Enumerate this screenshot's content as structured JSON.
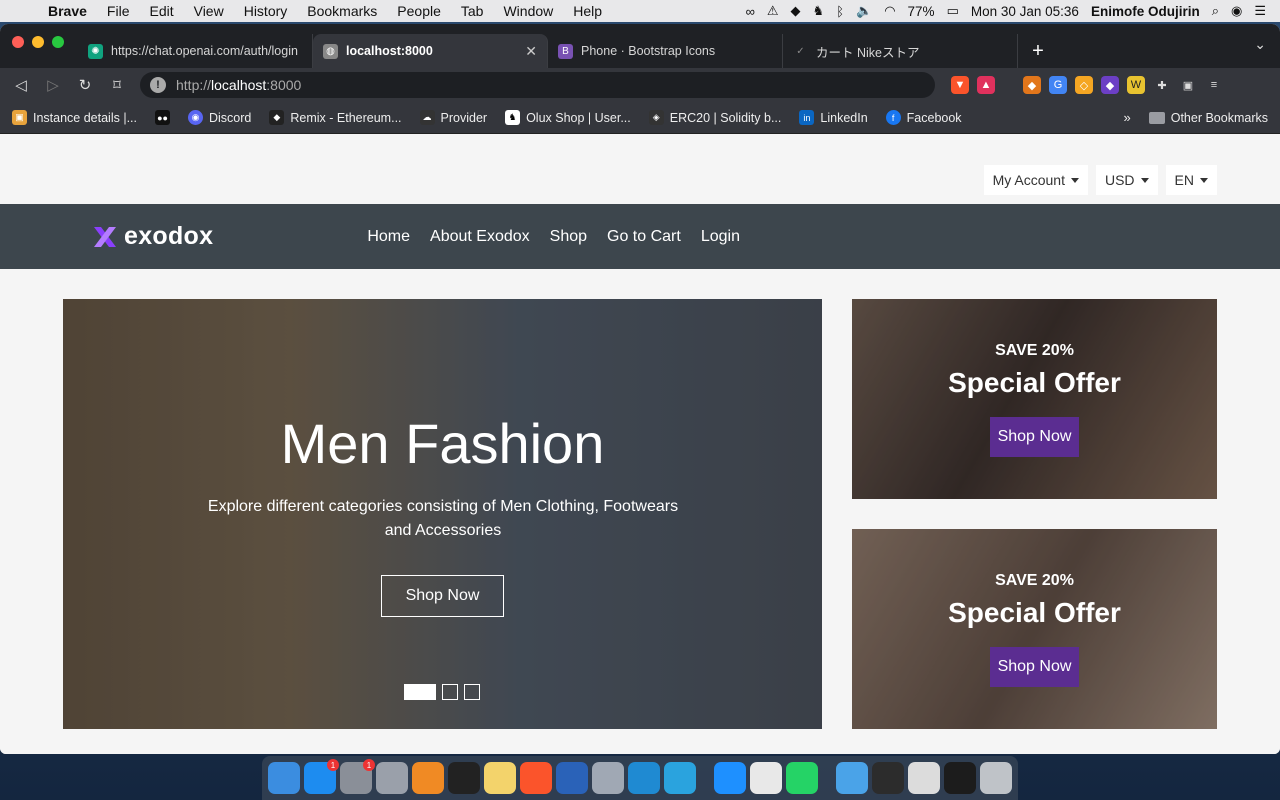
{
  "menubar": {
    "app_name": "Brave",
    "items": [
      "File",
      "Edit",
      "View",
      "History",
      "Bookmarks",
      "People",
      "Tab",
      "Window",
      "Help"
    ],
    "battery": "77%",
    "datetime": "Mon 30 Jan  05:36",
    "user": "Enimofe Odujirin"
  },
  "tabs": [
    {
      "title": "https://chat.openai.com/auth/login",
      "color": "#10a37f",
      "icon": "openai-icon"
    },
    {
      "title": "localhost:8000",
      "color": "#888888",
      "icon": "globe-icon"
    },
    {
      "title": "Phone · Bootstrap Icons",
      "color": "#7952b3",
      "icon": "bootstrap-icon"
    },
    {
      "title": "カート Nikeストア",
      "color": "#444444",
      "icon": "nike-icon"
    }
  ],
  "omnibox": {
    "scheme": "http://",
    "host": "localhost",
    "port": ":8000"
  },
  "bookmarks": [
    {
      "label": "Instance details |...",
      "color": "#e8a33c"
    },
    {
      "label": "",
      "color": "#111111"
    },
    {
      "label": "Discord",
      "color": "#5865f2"
    },
    {
      "label": "Remix - Ethereum...",
      "color": "#222222"
    },
    {
      "label": "Provider",
      "color": "#333333"
    },
    {
      "label": "Olux Shop | User...",
      "color": "#ffffff"
    },
    {
      "label": "ERC20 | Solidity b...",
      "color": "#333333"
    },
    {
      "label": "LinkedIn",
      "color": "#0a66c2"
    },
    {
      "label": "Facebook",
      "color": "#1877f2"
    }
  ],
  "bookmarks_more": "»",
  "other_bookmarks": "Other Bookmarks",
  "topbar": {
    "account": "My Account",
    "currency": "USD",
    "language": "EN"
  },
  "nav": {
    "logo": "exodox",
    "links": [
      "Home",
      "About Exodox",
      "Shop",
      "Go to Cart",
      "Login"
    ]
  },
  "hero": {
    "title": "Men Fashion",
    "subtitle": "Explore different categories consisting of Men Clothing, Footwears and Accessories",
    "button": "Shop Now",
    "slides": 3,
    "active_slide": 0
  },
  "offers": [
    {
      "kicker": "SAVE 20%",
      "title": "Special Offer",
      "button": "Shop Now"
    },
    {
      "kicker": "SAVE 20%",
      "title": "Special Offer",
      "button": "Shop Now"
    }
  ],
  "colors": {
    "navbar": "#3d464d",
    "accent": "#5b2d91",
    "logo_mark": "#8a3ffc"
  },
  "dock": [
    {
      "name": "finder-icon",
      "color": "#3b8de0"
    },
    {
      "name": "app-store-icon",
      "color": "#1d8cf0",
      "badge": "1"
    },
    {
      "name": "system-preferences-icon",
      "color": "#8a8f98",
      "badge": "1"
    },
    {
      "name": "launchpad-icon",
      "color": "#9aa0aa"
    },
    {
      "name": "vlc-icon",
      "color": "#f08a24"
    },
    {
      "name": "terminal-icon",
      "color": "#222222"
    },
    {
      "name": "notes-icon",
      "color": "#f3d36b"
    },
    {
      "name": "brave-icon",
      "color": "#fb542b"
    },
    {
      "name": "virtualbox-icon",
      "color": "#2a62b8"
    },
    {
      "name": "utility-icon",
      "color": "#a0a8b4"
    },
    {
      "name": "vscode-icon",
      "color": "#1f8ad2"
    },
    {
      "name": "telegram-icon",
      "color": "#2aa3de"
    },
    {
      "name": "safari-icon",
      "color": "#1e90ff"
    },
    {
      "name": "textedit-icon",
      "color": "#e8e8e8"
    },
    {
      "name": "whatsapp-icon",
      "color": "#25d366"
    },
    {
      "name": "folder-icon",
      "color": "#4aa3e8"
    },
    {
      "name": "window-thumb-icon",
      "color": "#2c2c2c"
    },
    {
      "name": "window-thumb-icon",
      "color": "#dcdcdc"
    },
    {
      "name": "window-thumb-icon",
      "color": "#1c1c1c"
    },
    {
      "name": "trash-icon",
      "color": "#bfc3c8"
    }
  ]
}
